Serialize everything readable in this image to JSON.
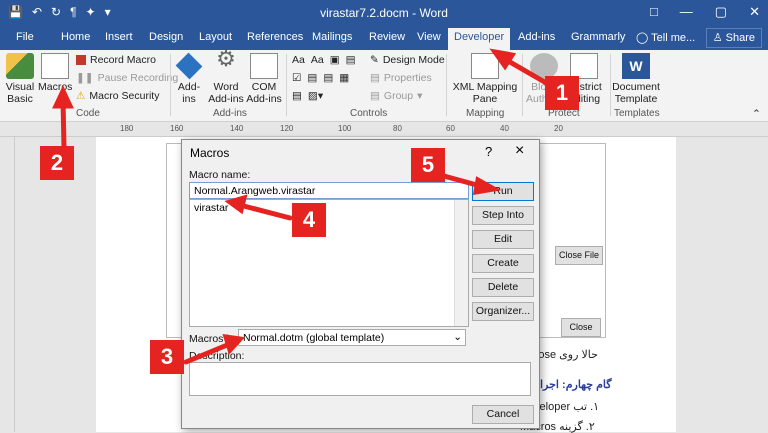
{
  "window": {
    "title": "virastar7.2.docm - Word"
  },
  "tabs": [
    {
      "label": "File"
    },
    {
      "label": "Home"
    },
    {
      "label": "Insert"
    },
    {
      "label": "Design"
    },
    {
      "label": "Layout"
    },
    {
      "label": "References"
    },
    {
      "label": "Mailings"
    },
    {
      "label": "Review"
    },
    {
      "label": "View"
    },
    {
      "label": "Developer"
    },
    {
      "label": "Add-ins"
    },
    {
      "label": "Grammarly"
    }
  ],
  "tell_me": "Tell me...",
  "share": "Share",
  "ribbon": {
    "code": {
      "visual_basic": "Visual Basic",
      "macros": "Macros",
      "record_macro": "Record Macro",
      "pause_recording": "Pause Recording",
      "macro_security": "Macro Security",
      "group": "Code"
    },
    "addins": {
      "addins": "Add-ins",
      "word_addins": "Word Add-ins",
      "com_addins": "COM Add-ins",
      "group": "Add-ins"
    },
    "controls": {
      "design_mode": "Design Mode",
      "properties": "Properties",
      "group_btn": "Group",
      "group": "Controls"
    },
    "mapping": {
      "xml_mapping_pane": "XML Mapping Pane",
      "group": "Mapping"
    },
    "protect": {
      "block_authors": "Block Authors",
      "restrict_editing": "Restrict Editing",
      "group": "Protect"
    },
    "templates": {
      "document_template": "Document Template",
      "group": "Templates"
    }
  },
  "ruler_labels": [
    "180",
    "160",
    "140",
    "120",
    "100",
    "80",
    "60",
    "40",
    "20"
  ],
  "dialog": {
    "title": "Macros",
    "help": "?",
    "macro_name_label": "Macro name:",
    "macro_name_value": "Normal.Arangweb.virastar",
    "list_items": [
      "virastar"
    ],
    "macros_in_label": "Macros in:",
    "macros_in_value": "Normal.dotm (global template)",
    "description_label": "Description:",
    "buttons": {
      "run": "Run",
      "step_into": "Step Into",
      "edit": "Edit",
      "create": "Create",
      "delete": "Delete",
      "organizer": "Organizer...",
      "cancel": "Cancel"
    }
  },
  "background_dialog": {
    "close_file": "Close File",
    "close": "Close"
  },
  "document_text": {
    "line1": "حالا روی Close",
    "line2": "گام چهارم: اجرا",
    "line3": "۱. تب Developer",
    "line4": "۲. گزینه Macros"
  },
  "annotations": [
    "1",
    "2",
    "3",
    "4",
    "5"
  ],
  "colors": {
    "word_blue": "#2b579a",
    "annotation_red": "#e52421",
    "ribbon_bg": "#f3f3f3"
  }
}
